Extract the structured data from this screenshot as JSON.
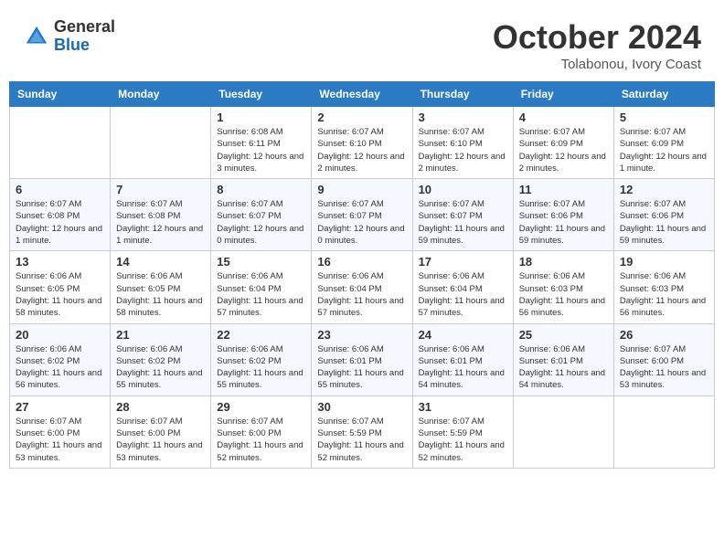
{
  "header": {
    "logo_general": "General",
    "logo_blue": "Blue",
    "month_title": "October 2024",
    "location": "Tolabonou, Ivory Coast"
  },
  "calendar": {
    "days_of_week": [
      "Sunday",
      "Monday",
      "Tuesday",
      "Wednesday",
      "Thursday",
      "Friday",
      "Saturday"
    ],
    "weeks": [
      [
        {
          "day": "",
          "info": ""
        },
        {
          "day": "",
          "info": ""
        },
        {
          "day": "1",
          "info": "Sunrise: 6:08 AM\nSunset: 6:11 PM\nDaylight: 12 hours and 3 minutes."
        },
        {
          "day": "2",
          "info": "Sunrise: 6:07 AM\nSunset: 6:10 PM\nDaylight: 12 hours and 2 minutes."
        },
        {
          "day": "3",
          "info": "Sunrise: 6:07 AM\nSunset: 6:10 PM\nDaylight: 12 hours and 2 minutes."
        },
        {
          "day": "4",
          "info": "Sunrise: 6:07 AM\nSunset: 6:09 PM\nDaylight: 12 hours and 2 minutes."
        },
        {
          "day": "5",
          "info": "Sunrise: 6:07 AM\nSunset: 6:09 PM\nDaylight: 12 hours and 1 minute."
        }
      ],
      [
        {
          "day": "6",
          "info": "Sunrise: 6:07 AM\nSunset: 6:08 PM\nDaylight: 12 hours and 1 minute."
        },
        {
          "day": "7",
          "info": "Sunrise: 6:07 AM\nSunset: 6:08 PM\nDaylight: 12 hours and 1 minute."
        },
        {
          "day": "8",
          "info": "Sunrise: 6:07 AM\nSunset: 6:07 PM\nDaylight: 12 hours and 0 minutes."
        },
        {
          "day": "9",
          "info": "Sunrise: 6:07 AM\nSunset: 6:07 PM\nDaylight: 12 hours and 0 minutes."
        },
        {
          "day": "10",
          "info": "Sunrise: 6:07 AM\nSunset: 6:07 PM\nDaylight: 11 hours and 59 minutes."
        },
        {
          "day": "11",
          "info": "Sunrise: 6:07 AM\nSunset: 6:06 PM\nDaylight: 11 hours and 59 minutes."
        },
        {
          "day": "12",
          "info": "Sunrise: 6:07 AM\nSunset: 6:06 PM\nDaylight: 11 hours and 59 minutes."
        }
      ],
      [
        {
          "day": "13",
          "info": "Sunrise: 6:06 AM\nSunset: 6:05 PM\nDaylight: 11 hours and 58 minutes."
        },
        {
          "day": "14",
          "info": "Sunrise: 6:06 AM\nSunset: 6:05 PM\nDaylight: 11 hours and 58 minutes."
        },
        {
          "day": "15",
          "info": "Sunrise: 6:06 AM\nSunset: 6:04 PM\nDaylight: 11 hours and 57 minutes."
        },
        {
          "day": "16",
          "info": "Sunrise: 6:06 AM\nSunset: 6:04 PM\nDaylight: 11 hours and 57 minutes."
        },
        {
          "day": "17",
          "info": "Sunrise: 6:06 AM\nSunset: 6:04 PM\nDaylight: 11 hours and 57 minutes."
        },
        {
          "day": "18",
          "info": "Sunrise: 6:06 AM\nSunset: 6:03 PM\nDaylight: 11 hours and 56 minutes."
        },
        {
          "day": "19",
          "info": "Sunrise: 6:06 AM\nSunset: 6:03 PM\nDaylight: 11 hours and 56 minutes."
        }
      ],
      [
        {
          "day": "20",
          "info": "Sunrise: 6:06 AM\nSunset: 6:02 PM\nDaylight: 11 hours and 56 minutes."
        },
        {
          "day": "21",
          "info": "Sunrise: 6:06 AM\nSunset: 6:02 PM\nDaylight: 11 hours and 55 minutes."
        },
        {
          "day": "22",
          "info": "Sunrise: 6:06 AM\nSunset: 6:02 PM\nDaylight: 11 hours and 55 minutes."
        },
        {
          "day": "23",
          "info": "Sunrise: 6:06 AM\nSunset: 6:01 PM\nDaylight: 11 hours and 55 minutes."
        },
        {
          "day": "24",
          "info": "Sunrise: 6:06 AM\nSunset: 6:01 PM\nDaylight: 11 hours and 54 minutes."
        },
        {
          "day": "25",
          "info": "Sunrise: 6:06 AM\nSunset: 6:01 PM\nDaylight: 11 hours and 54 minutes."
        },
        {
          "day": "26",
          "info": "Sunrise: 6:07 AM\nSunset: 6:00 PM\nDaylight: 11 hours and 53 minutes."
        }
      ],
      [
        {
          "day": "27",
          "info": "Sunrise: 6:07 AM\nSunset: 6:00 PM\nDaylight: 11 hours and 53 minutes."
        },
        {
          "day": "28",
          "info": "Sunrise: 6:07 AM\nSunset: 6:00 PM\nDaylight: 11 hours and 53 minutes."
        },
        {
          "day": "29",
          "info": "Sunrise: 6:07 AM\nSunset: 6:00 PM\nDaylight: 11 hours and 52 minutes."
        },
        {
          "day": "30",
          "info": "Sunrise: 6:07 AM\nSunset: 5:59 PM\nDaylight: 11 hours and 52 minutes."
        },
        {
          "day": "31",
          "info": "Sunrise: 6:07 AM\nSunset: 5:59 PM\nDaylight: 11 hours and 52 minutes."
        },
        {
          "day": "",
          "info": ""
        },
        {
          "day": "",
          "info": ""
        }
      ]
    ]
  }
}
